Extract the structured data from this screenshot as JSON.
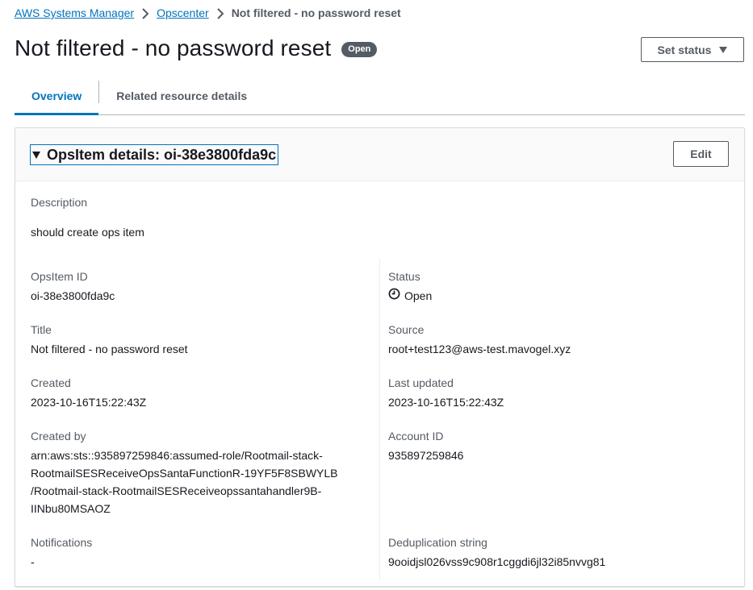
{
  "breadcrumb": {
    "items": [
      "AWS Systems Manager",
      "Opscenter"
    ],
    "current": "Not filtered - no password reset"
  },
  "page": {
    "title": "Not filtered - no password reset",
    "badge": "Open",
    "set_status_label": "Set status"
  },
  "tabs": [
    "Overview",
    "Related resource details"
  ],
  "panel": {
    "header": "OpsItem details: oi-38e3800fda9c",
    "edit_label": "Edit",
    "description_label": "Description",
    "description_value": "should create ops item",
    "left": {
      "opsitem_id_label": "OpsItem ID",
      "opsitem_id_value": "oi-38e3800fda9c",
      "title_label": "Title",
      "title_value": "Not filtered - no password reset",
      "created_label": "Created",
      "created_value": "2023-10-16T15:22:43Z",
      "created_by_label": "Created by",
      "created_by_lines": [
        "arn:aws:sts::935897259846:assumed-role/Rootmail-stack-",
        "RootmailSESReceiveOpsSantaFunctionR-19YF5F8SBWYLB",
        "/Rootmail-stack-RootmailSESReceiveopssantahandler9B-",
        "IINbu80MSAOZ"
      ],
      "notifications_label": "Notifications",
      "notifications_value": "-"
    },
    "right": {
      "status_label": "Status",
      "status_value": "Open",
      "source_label": "Source",
      "source_value": "root+test123@aws-test.mavogel.xyz",
      "last_updated_label": "Last updated",
      "last_updated_value": "2023-10-16T15:22:43Z",
      "account_id_label": "Account ID",
      "account_id_value": "935897259846",
      "dedup_label": "Deduplication string",
      "dedup_value": "9ooidjsl026vss9c908r1cggdi6jl32i85nvvg81"
    }
  }
}
